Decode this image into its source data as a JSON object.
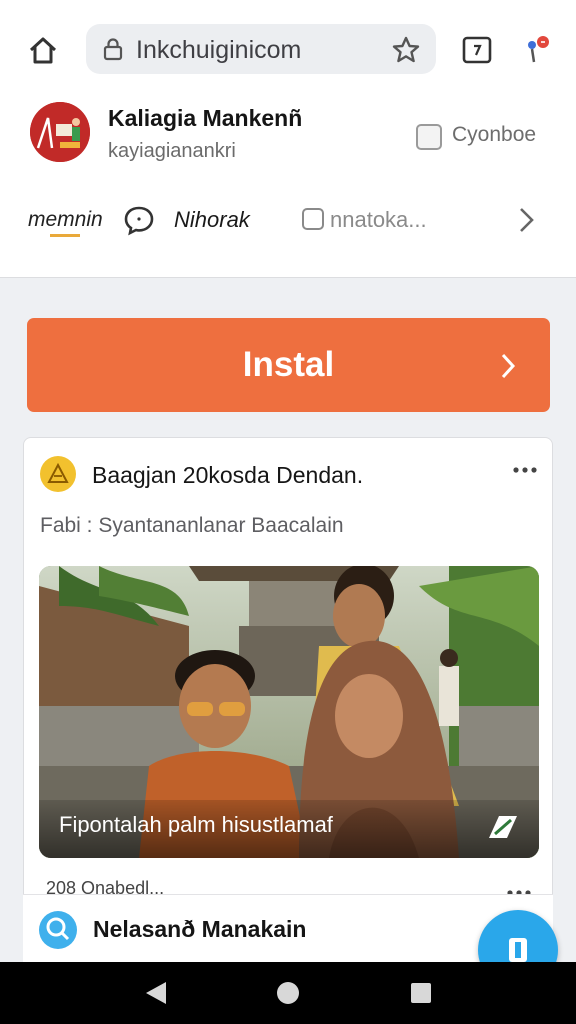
{
  "browser": {
    "url": "Inkchuiginicom"
  },
  "profile": {
    "name": "Kaliagia Mankenñ",
    "handle": "kayiagianankri",
    "follow_label": "Cyonboe"
  },
  "nav": {
    "item1": "memnin",
    "item2": "Nihorak",
    "item3": "nnatoka..."
  },
  "install": {
    "label": "Instal"
  },
  "post": {
    "title": "Baagjan 20kosda Dendan.",
    "subtitle": "Fabi : Syantananlanar Baacalain",
    "caption": "Fipontalah palm hisustlamaf",
    "footer": "208  Onabedl..."
  },
  "next_post": {
    "title": "Nelasanð Manakain"
  },
  "colors": {
    "accent": "#ee6f3f",
    "fab": "#2aa7ea",
    "badge": "#f2c12e"
  }
}
